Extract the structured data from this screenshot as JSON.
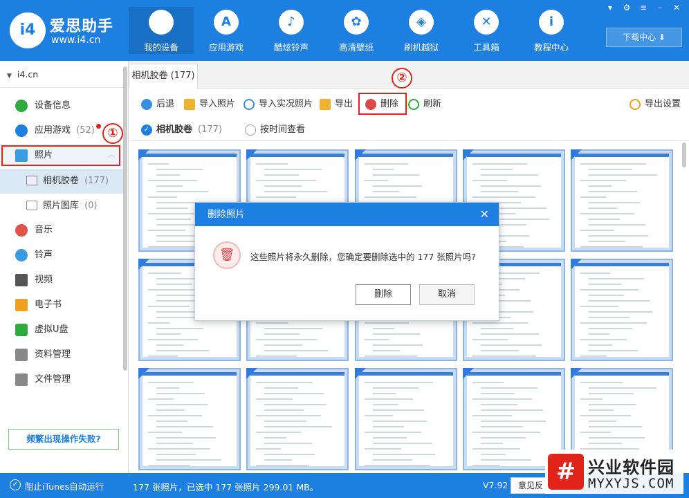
{
  "brand": {
    "badge": "i4",
    "name": "爱思助手",
    "url": "www.i4.cn"
  },
  "nav": [
    {
      "label": "我的设备",
      "icon": "apple-icon",
      "glyph": ""
    },
    {
      "label": "应用游戏",
      "icon": "app-store-icon",
      "glyph": "A"
    },
    {
      "label": "酷炫铃声",
      "icon": "bell-icon",
      "glyph": "♪"
    },
    {
      "label": "高清壁纸",
      "icon": "flower-icon",
      "glyph": "✿"
    },
    {
      "label": "刷机越狱",
      "icon": "dropbox-icon",
      "glyph": "◈"
    },
    {
      "label": "工具箱",
      "icon": "tools-icon",
      "glyph": "✕"
    },
    {
      "label": "教程中心",
      "icon": "info-icon",
      "glyph": "i"
    }
  ],
  "window": {
    "download_label": "下载中心 ⬇"
  },
  "sidebar": {
    "root": "i4.cn",
    "items": [
      {
        "label": "设备信息",
        "icon": "info-circle-icon",
        "color": "#2eaa3f"
      },
      {
        "label": "应用游戏",
        "count": "(52)",
        "icon": "app-store-icon",
        "color": "#1d7fe0"
      },
      {
        "label": "照片",
        "icon": "photo-icon",
        "color": "#3a9be0"
      },
      {
        "label": "相机胶卷",
        "count": "(177)",
        "icon": "folder-icon"
      },
      {
        "label": "照片图库",
        "count": "(0)",
        "icon": "folder-icon"
      },
      {
        "label": "音乐",
        "icon": "music-icon",
        "color": "#e0524a"
      },
      {
        "label": "铃声",
        "icon": "bell-icon",
        "color": "#3a9be0"
      },
      {
        "label": "视频",
        "icon": "film-icon",
        "color": "#555"
      },
      {
        "label": "电子书",
        "icon": "book-icon",
        "color": "#f0a020"
      },
      {
        "label": "虚拟U盘",
        "icon": "usb-icon",
        "color": "#2eaa3f"
      },
      {
        "label": "资料管理",
        "icon": "contacts-icon",
        "color": "#888"
      },
      {
        "label": "文件管理",
        "icon": "file-icon",
        "color": "#888"
      }
    ],
    "fail_link": "频繁出现操作失败?"
  },
  "tab": {
    "label": "相机胶卷 (177)"
  },
  "toolbar": {
    "back": "后退",
    "import_photos": "导入照片",
    "import_live": "导入实况照片",
    "export": "导出",
    "delete": "删除",
    "refresh": "刷新",
    "export_settings": "导出设置"
  },
  "filter": {
    "camera_roll": "相机胶卷",
    "camera_roll_count": "(177)",
    "by_time": "按时间查看"
  },
  "annotations": {
    "step1": "①",
    "step2": "②"
  },
  "dialog": {
    "title": "删除照片",
    "message": "这些照片将永久删除，您确定要删除选中的 177 张照片吗?",
    "confirm": "删除",
    "cancel": "取消"
  },
  "status": {
    "itunes": "阻止iTunes自动运行",
    "summary": "177 张照片，已选中 177 张照片 299.01 MB。",
    "version": "V7.92",
    "feedback": "意见反"
  },
  "watermark": {
    "logo": "#",
    "title": "兴业软件园",
    "url": "MYXYJS.COM"
  },
  "colors": {
    "accent": "#1d7fe0",
    "danger": "#e2231a"
  }
}
